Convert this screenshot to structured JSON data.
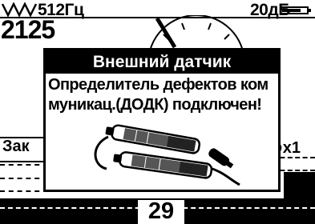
{
  "status": {
    "frequency": "512Гц",
    "gain": "20дБ",
    "battery_level": 0.75
  },
  "reading": {
    "value": "2125"
  },
  "background": {
    "left_label": "Зак",
    "right_label": "⊘x1",
    "bottom_value": "29"
  },
  "dialog": {
    "title": "Внешний датчик",
    "message": "Определитель дефектов ком\nмуникац.(ДОДК) подключен!"
  },
  "icons": {
    "wave": "waveform-icon",
    "battery": "battery-icon",
    "sensor": "sensor-probe-icon"
  }
}
